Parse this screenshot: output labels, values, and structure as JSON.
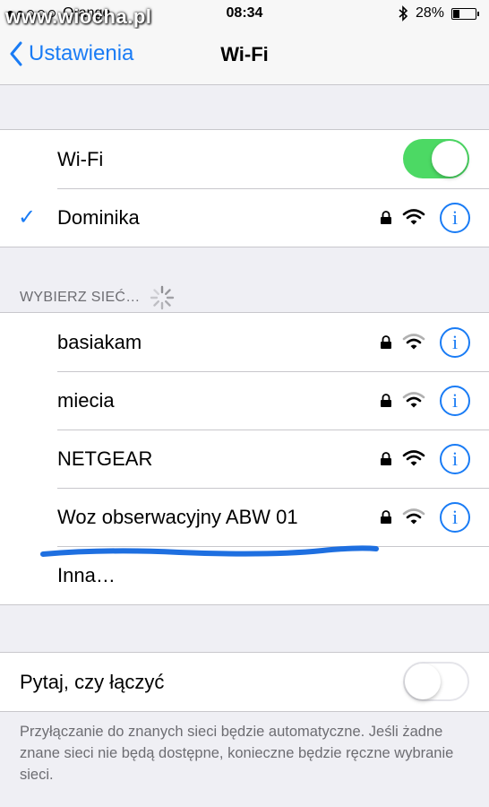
{
  "status": {
    "carrier": "Orange",
    "time": "08:34",
    "battery_text": "28%",
    "battery_level": 0.28
  },
  "watermark": "www.wiocha.pl",
  "nav": {
    "back_label": "Ustawienia",
    "title": "Wi-Fi"
  },
  "wifi_toggle": {
    "label": "Wi-Fi",
    "on": true
  },
  "connected_network": {
    "name": "Dominika",
    "info": "i"
  },
  "section_header": "WYBIERZ SIEĆ…",
  "networks": [
    {
      "name": "basiakam",
      "info": "i"
    },
    {
      "name": "miecia",
      "info": "i"
    },
    {
      "name": "NETGEAR",
      "info": "i"
    },
    {
      "name": "Woz obserwacyjny ABW 01",
      "info": "i"
    }
  ],
  "other_label": "Inna…",
  "ask_join": {
    "label": "Pytaj, czy łączyć",
    "on": false
  },
  "footer_note": "Przyłączanie do znanych sieci będzie automatyczne. Jeśli żadne znane sieci nie będą dostępne, konieczne będzie ręczne wybranie sieci.",
  "colors": {
    "accent": "#1a7cf5",
    "toggle_on": "#4cd964",
    "background": "#efeff4",
    "annotation_line": "#1e6fe0"
  }
}
